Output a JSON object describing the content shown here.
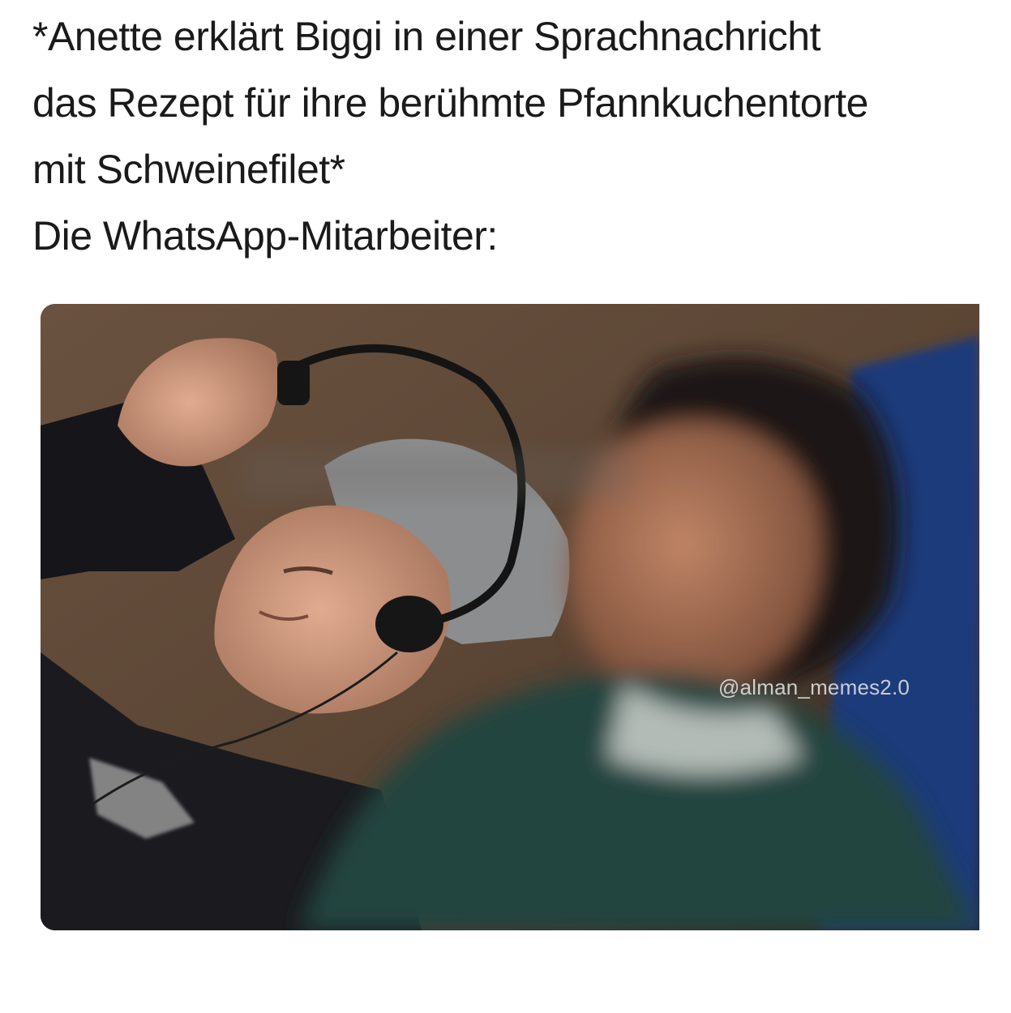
{
  "caption": {
    "lines": [
      "*Anette erklärt Biggi in einer Sprachnachricht",
      "das Rezept für ihre berühmte Pfannkuchentorte",
      "mit Schweinefilet*",
      "Die WhatsApp-Mitarbeiter:"
    ]
  },
  "photo": {
    "watermark": "@alman_memes2.0"
  },
  "colors": {
    "text": "#1a1a1a",
    "background": "#ffffff"
  }
}
